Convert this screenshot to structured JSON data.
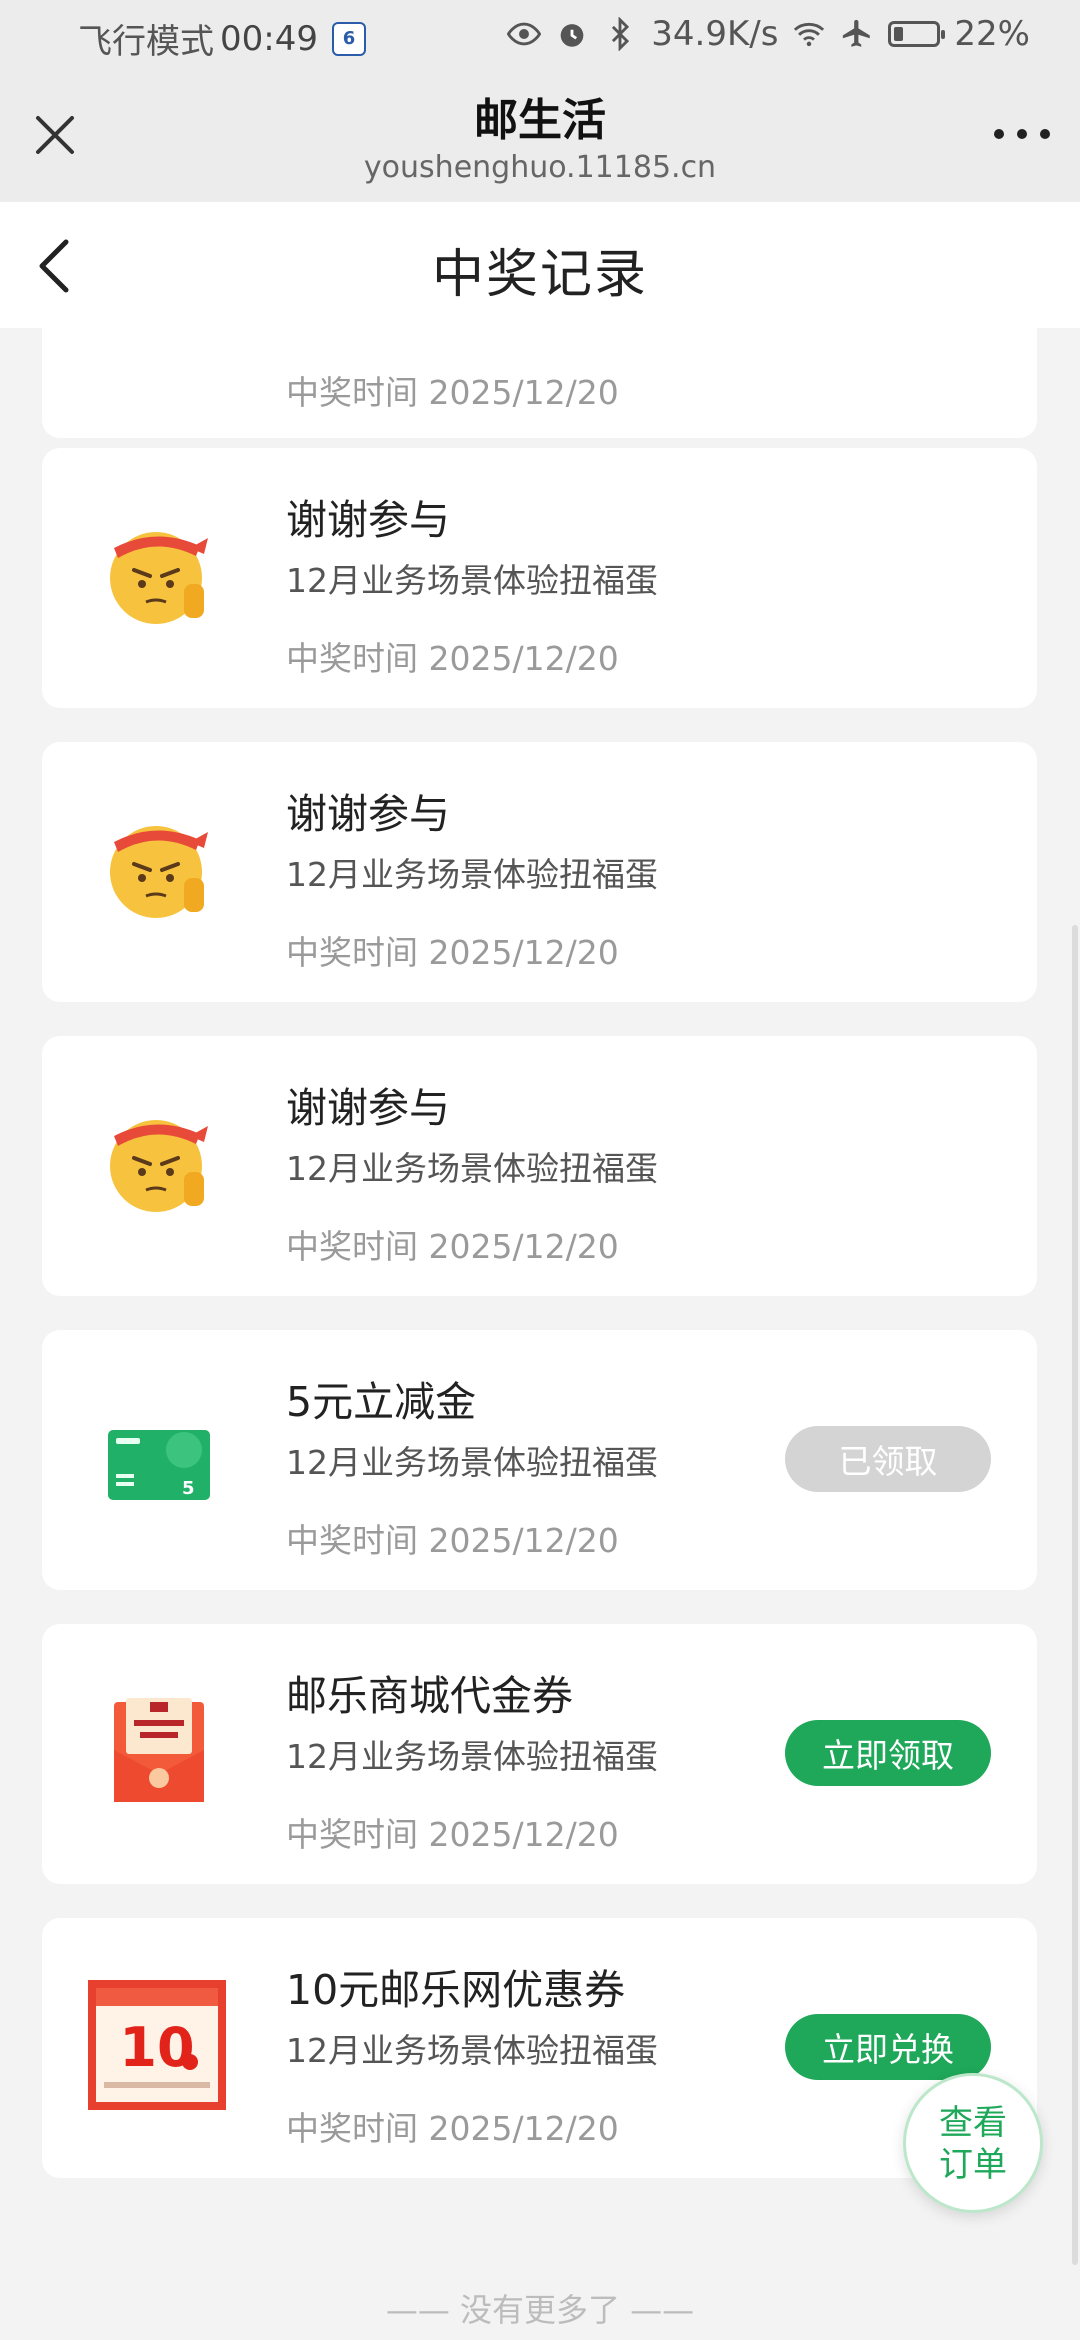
{
  "status_bar": {
    "mode": "飞行模式",
    "time": "00:49",
    "speed": "34.9K/s",
    "battery": "22%",
    "battery_level": 0.22
  },
  "browser": {
    "title": "邮生活",
    "url": "youshenghuo.11185.cn"
  },
  "page": {
    "title": "中奖记录"
  },
  "records": [
    {
      "name": "",
      "sub": "",
      "time": "中奖时间 2025/12/20"
    },
    {
      "name": "谢谢参与",
      "sub": "12月业务场景体验扭福蛋",
      "time": "中奖时间 2025/12/20",
      "icon": "thanks-emoji-icon"
    },
    {
      "name": "谢谢参与",
      "sub": "12月业务场景体验扭福蛋",
      "time": "中奖时间 2025/12/20",
      "icon": "thanks-emoji-icon"
    },
    {
      "name": "谢谢参与",
      "sub": "12月业务场景体验扭福蛋",
      "time": "中奖时间 2025/12/20",
      "icon": "thanks-emoji-icon"
    },
    {
      "name": "5元立减金",
      "sub": "12月业务场景体验扭福蛋",
      "time": "中奖时间 2025/12/20",
      "icon": "voucher-card-icon",
      "button": "已领取"
    },
    {
      "name": "邮乐商城代金券",
      "sub": "12月业务场景体验扭福蛋",
      "time": "中奖时间 2025/12/20",
      "icon": "red-envelope-icon",
      "button": "立即领取"
    },
    {
      "name": "10元邮乐网优惠券",
      "sub": "12月业务场景体验扭福蛋",
      "time": "中奖时间 2025/12/20",
      "icon": "coupon-10-icon",
      "button": "立即兑换"
    }
  ],
  "footer": {
    "no_more": "—— 没有更多了 ——"
  },
  "fab": {
    "line1": "查看",
    "line2": "订单"
  },
  "colors": {
    "accent": "#1fa85a",
    "claimed": "#d4d4d4"
  }
}
